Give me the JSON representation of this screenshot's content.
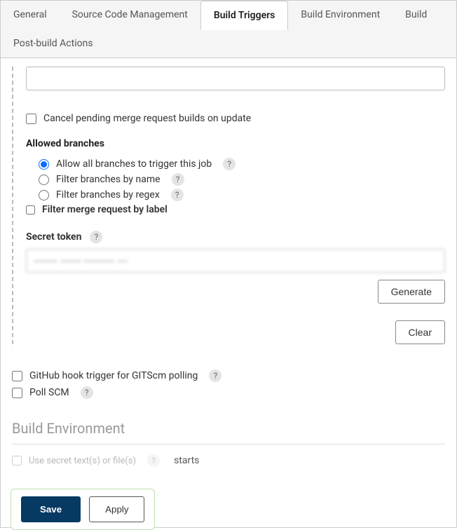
{
  "tabs": {
    "general": "General",
    "scm": "Source Code Management",
    "build_triggers": "Build Triggers",
    "build_env": "Build Environment",
    "build": "Build",
    "post_build": "Post-build Actions"
  },
  "triggers": {
    "cancel_pending": "Cancel pending merge request builds on update",
    "allowed_branches_title": "Allowed branches",
    "branch_allow_all": "Allow all branches to trigger this job",
    "branch_by_name": "Filter branches by name",
    "branch_by_regex": "Filter branches by regex",
    "filter_mr_label": "Filter merge request by label",
    "secret_token_label": "Secret token",
    "secret_token_value": "••••••• •••••• ••••••••• •••",
    "generate": "Generate",
    "clear": "Clear",
    "github_hook": "GitHub hook trigger for GITScm polling",
    "poll_scm": "Poll SCM"
  },
  "env": {
    "heading": "Build Environment",
    "use_secret": "Use secret text(s) or file(s)",
    "starts": "starts"
  },
  "footer": {
    "save": "Save",
    "apply": "Apply"
  },
  "help": "?"
}
